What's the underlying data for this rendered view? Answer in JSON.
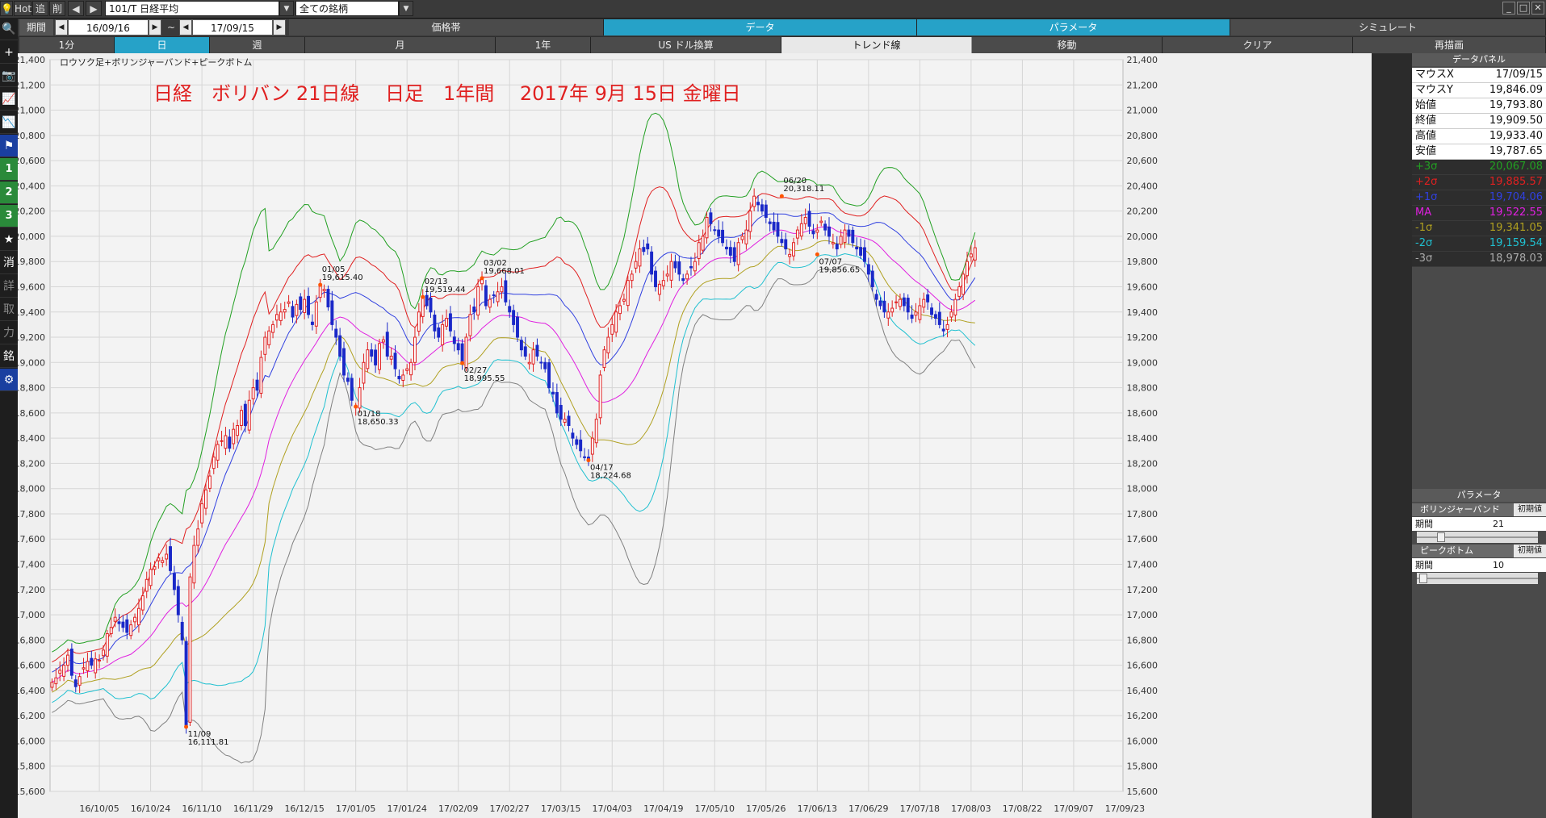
{
  "app": {
    "hot_label": "Hot",
    "add_label": "追",
    "del_label": "削",
    "symbol": "101/T 日経平均",
    "market_filter": "全ての銘柄"
  },
  "toolbar": {
    "period_label": "期間",
    "start_date": "16/09/16",
    "tilde": "~",
    "end_date": "17/09/15",
    "menu_tabs": [
      {
        "label": "価格帯",
        "active": false
      },
      {
        "label": "データ",
        "active": true
      },
      {
        "label": "パラメータ",
        "active": true
      },
      {
        "label": "シミュレート",
        "active": false
      }
    ],
    "sub_tabs": [
      {
        "label": "1分",
        "style": "dark"
      },
      {
        "label": "日",
        "style": "active"
      },
      {
        "label": "週",
        "style": "dark"
      },
      {
        "label": "月",
        "style": "dark"
      },
      {
        "label": "1年",
        "style": "dark"
      },
      {
        "label": "US ドル換算",
        "style": "dark"
      },
      {
        "label": "トレンド線",
        "style": "light"
      },
      {
        "label": "移動",
        "style": "dark"
      },
      {
        "label": "クリア",
        "style": "dark"
      },
      {
        "label": "再描画",
        "style": "dark"
      }
    ]
  },
  "left_toolbar": {
    "items": [
      {
        "label": "🔍",
        "name": "search-icon",
        "style": ""
      },
      {
        "label": "+",
        "name": "crosshair-icon",
        "style": ""
      },
      {
        "label": "📷",
        "name": "camera-icon",
        "style": ""
      },
      {
        "label": "📈",
        "name": "line-chart-icon",
        "style": ""
      },
      {
        "label": "📉",
        "name": "indicator-chart-icon",
        "style": ""
      },
      {
        "label": "⚑",
        "name": "flag-icon",
        "style": "blue"
      },
      {
        "label": "1",
        "name": "preset-1-button",
        "style": "num"
      },
      {
        "label": "2",
        "name": "preset-2-button",
        "style": "num"
      },
      {
        "label": "3",
        "name": "preset-3-button",
        "style": "num"
      },
      {
        "label": "★",
        "name": "star-icon",
        "style": ""
      },
      {
        "label": "消",
        "name": "erase-button",
        "style": ""
      },
      {
        "label": "詳",
        "name": "detail-button",
        "style": "gray"
      },
      {
        "label": "取",
        "name": "fetch-button",
        "style": "gray"
      },
      {
        "label": "力",
        "name": "power-button",
        "style": "gray"
      },
      {
        "label": "銘",
        "name": "symbol-button",
        "style": ""
      },
      {
        "label": "⚙",
        "name": "gear-icon",
        "style": "blue"
      }
    ]
  },
  "chart_header": {
    "indicator_label": "ロウソク足+ボリンジャーバンド+ピークボトム",
    "title": "日経　ボリバン 21日線　 日足　1年間　 2017年 9月 15日 金曜日"
  },
  "data_panel": {
    "title": "データパネル",
    "rows": [
      {
        "label": "マウスX",
        "value": "17/09/15",
        "color": "#111111",
        "dark": false
      },
      {
        "label": "マウスY",
        "value": "19,846.09",
        "color": "#111111",
        "dark": false
      },
      {
        "label": "始値",
        "value": "19,793.80",
        "color": "#111111",
        "dark": false
      },
      {
        "label": "終値",
        "value": "19,909.50",
        "color": "#111111",
        "dark": false
      },
      {
        "label": "高値",
        "value": "19,933.40",
        "color": "#111111",
        "dark": false
      },
      {
        "label": "安値",
        "value": "19,787.65",
        "color": "#111111",
        "dark": false
      },
      {
        "label": "+3σ",
        "value": "20,067.08",
        "color": "#22a022",
        "dark": true
      },
      {
        "label": "+2σ",
        "value": "19,885.57",
        "color": "#e02020",
        "dark": true
      },
      {
        "label": "+1σ",
        "value": "19,704.06",
        "color": "#3040e0",
        "dark": true
      },
      {
        "label": "MA",
        "value": "19,522.55",
        "color": "#e020e0",
        "dark": true
      },
      {
        "label": "-1σ",
        "value": "19,341.05",
        "color": "#b0a020",
        "dark": true
      },
      {
        "label": "-2σ",
        "value": "19,159.54",
        "color": "#20c0d0",
        "dark": true
      },
      {
        "label": "-3σ",
        "value": "18,978.03",
        "color": "#aaaaaa",
        "dark": true
      }
    ]
  },
  "param_panel": {
    "title": "パラメータ",
    "sections": [
      {
        "name": "ボリンジャーバンド",
        "reset": "初期値",
        "field": "期間",
        "value": "21",
        "slider": 0.18
      },
      {
        "name": "ピークボトム",
        "reset": "初期値",
        "field": "期間",
        "value": "10",
        "slider": 0.02
      }
    ]
  },
  "chart_data": {
    "type": "candlestick",
    "ylim": [
      15600,
      21400
    ],
    "y_ticks": [
      15600,
      15800,
      16000,
      16200,
      16400,
      16600,
      16800,
      17000,
      17200,
      17400,
      17600,
      17800,
      18000,
      18200,
      18400,
      18600,
      18800,
      19000,
      19200,
      19400,
      19600,
      19800,
      20000,
      20200,
      20400,
      20600,
      20800,
      21000,
      21200,
      21400
    ],
    "x_labels": [
      "16/10/05",
      "16/10/24",
      "16/11/10",
      "16/11/29",
      "16/12/15",
      "17/01/05",
      "17/01/24",
      "17/02/09",
      "17/02/27",
      "17/03/15",
      "17/04/03",
      "17/04/19",
      "17/05/10",
      "17/05/26",
      "17/06/13",
      "17/06/29",
      "17/07/18",
      "17/08/03",
      "17/08/22",
      "17/09/07",
      "17/09/23"
    ],
    "x_label_index": [
      12,
      25,
      38,
      51,
      64,
      77,
      90,
      103,
      116,
      129,
      142,
      155,
      168,
      181,
      194,
      207,
      220,
      233,
      246,
      259,
      272
    ],
    "colors": {
      "up": "#e02020",
      "down": "#1a28c8",
      "p3": "#22a022",
      "p2": "#e02020",
      "p1": "#3040e0",
      "ma": "#e020e0",
      "m1": "#b0a020",
      "m2": "#20c0d0",
      "m3": "#808080"
    },
    "closes": [
      16465,
      16500,
      16560,
      16600,
      16680,
      16520,
      16430,
      16510,
      16580,
      16630,
      16600,
      16650,
      16640,
      16720,
      16850,
      16900,
      16980,
      16930,
      16900,
      16860,
      16920,
      16980,
      17050,
      17150,
      17280,
      17360,
      17380,
      17450,
      17430,
      17480,
      17350,
      17200,
      17000,
      16800,
      16111.81,
      17300,
      17550,
      17680,
      17880,
      17990,
      18100,
      18250,
      18350,
      18380,
      18420,
      18320,
      18470,
      18500,
      18620,
      18500,
      18700,
      18800,
      18780,
      19040,
      19200,
      19250,
      19300,
      19380,
      19400,
      19420,
      19480,
      19360,
      19460,
      19420,
      19500,
      19380,
      19300,
      19480,
      19615.4,
      19580,
      19440,
      19300,
      19200,
      19050,
      18900,
      18850,
      18700,
      18650.33,
      18800,
      19000,
      19100,
      19050,
      18980,
      19150,
      19180,
      19050,
      19050,
      18950,
      18870,
      18900,
      18950,
      19000,
      19200,
      19400,
      19519.44,
      19450,
      19400,
      19250,
      19200,
      19300,
      19350,
      19250,
      19150,
      19100,
      18995.55,
      19200,
      19380,
      19400,
      19600,
      19668.01,
      19450,
      19500,
      19530,
      19560,
      19600,
      19480,
      19400,
      19300,
      19200,
      19100,
      19050,
      19000,
      19100,
      19050,
      19000,
      18950,
      18800,
      18750,
      18600,
      18550,
      18550,
      18500,
      18400,
      18350,
      18300,
      18250,
      18224.68,
      18400,
      18550,
      18900,
      19100,
      19200,
      19300,
      19400,
      19450,
      19500,
      19650,
      19700,
      19800,
      19900,
      19880,
      19900,
      19700,
      19600,
      19620,
      19650,
      19700,
      19800,
      19750,
      19700,
      19650,
      19700,
      19750,
      19800,
      19950,
      20000,
      20150,
      20100,
      20050,
      20000,
      19950,
      19900,
      19850,
      19800,
      19950,
      20000,
      20050,
      20200,
      20318.11,
      20250,
      20200,
      20150,
      20100,
      20050,
      20000,
      19950,
      19900,
      19856.65,
      19950,
      20050,
      20100,
      20150,
      20080,
      20020,
      20050,
      20120,
      20050,
      20000,
      19950,
      19900,
      20000,
      20050,
      20000,
      19950,
      19900,
      19850,
      19800,
      19700,
      19600,
      19500,
      19450,
      19400,
      19400,
      19430,
      19480,
      19500,
      19450,
      19400,
      19350,
      19400,
      19450,
      19500,
      19480,
      19380,
      19350,
      19300,
      19250,
      19300,
      19400,
      19500,
      19600,
      19700,
      19800,
      19860,
      19909.5
    ],
    "peaks": [
      {
        "i": 34,
        "price": 16111.81,
        "date": "11/09",
        "value": "16,111.81",
        "pos": "below"
      },
      {
        "i": 68,
        "price": 19615.4,
        "date": "01/05",
        "value": "19,615.40",
        "pos": "above"
      },
      {
        "i": 77,
        "price": 18650.33,
        "date": "01/18",
        "value": "18,650.33",
        "pos": "below"
      },
      {
        "i": 94,
        "price": 19519.44,
        "date": "02/13",
        "value": "19,519.44",
        "pos": "above"
      },
      {
        "i": 104,
        "price": 18995.55,
        "date": "02/27",
        "value": "18,995.55",
        "pos": "below"
      },
      {
        "i": 109,
        "price": 19668.01,
        "date": "03/02",
        "value": "19,668.01",
        "pos": "above"
      },
      {
        "i": 136,
        "price": 18224.68,
        "date": "04/17",
        "value": "18,224.68",
        "pos": "below"
      },
      {
        "i": 185,
        "price": 20318.11,
        "date": "06/20",
        "value": "20,318.11",
        "pos": "above"
      },
      {
        "i": 194,
        "price": 19856.65,
        "date": "07/07",
        "value": "19,856.65",
        "pos": "below"
      }
    ]
  }
}
